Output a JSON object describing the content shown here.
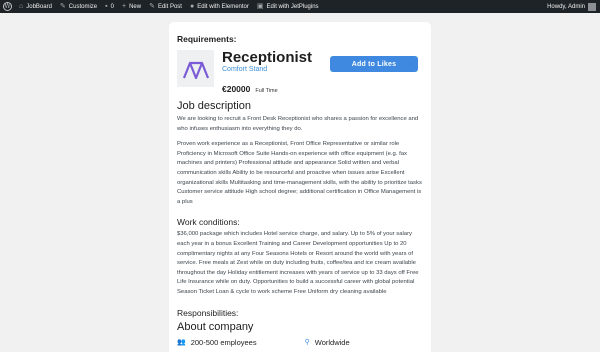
{
  "adminbar": {
    "site_name": "JobBoard",
    "customize": "Customize",
    "comments_count": "0",
    "new_label": "New",
    "edit_post": "Edit Post",
    "edit_elementor": "Edit with Elementor",
    "edit_jetplugins": "Edit with JetPlugins",
    "howdy": "Howdy, Admin"
  },
  "job": {
    "requirements_heading": "Requirements:",
    "title": "Receptionist",
    "company": "Comfort Stand",
    "salary": "€20000",
    "job_type": "Full Time",
    "add_to_likes": "Add to Likes",
    "description_heading": "Job description",
    "description_p1": "We are looking to recruit a Front Desk Receptionist who shares a passion for excellence and who infuses enthusiasm into everything they do.",
    "description_p2": "Proven work experience as a Receptionist, Front Office Representative or similar role Proficiency in Microsoft Office Suite Hands-on experience with office equipment (e.g. fax machines and printers) Professional attitude and appearance Solid written and verbal communication skills Ability to be resourceful and proactive when issues arise Excellent organizational skills Multitasking and time-management skills, with the ability to prioritize tasks Customer service attitude High school degree; additional certification in Office Management is a plus",
    "work_conditions_heading": "Work conditions:",
    "work_conditions_text": "$36,000 package which includes Hotel service charge, and salary. Up to 5% of your salary each year in a bonus Excellent Training and Career Development opportunities Up to 20 complimentary nights at any Four Seasons Hotels or Resort around the world with years of service. Free meals at Zest while on duty including fruits, coffee/tea and ice cream available throughout the day Holiday entitlement increases with years of service up to 33 days off Free Life Insurance while on duty. Opportunities to build a successful career with global potential Season Ticket Loan & cycle to work scheme Free Uniform dry cleaning available",
    "responsibilities_heading": "Responsibilities:",
    "about_heading": "About company",
    "employees": "200-500 employees",
    "location": "Worldwide"
  },
  "colors": {
    "adminbar_bg": "#1d2327",
    "page_bg": "#f1f1f1",
    "accent": "#3f8ae0",
    "logo_purple": "#7b5cd6"
  },
  "icons": {
    "wp": "wordpress-icon",
    "home": "home-icon",
    "customize": "brush-icon",
    "comments": "comment-icon",
    "new": "plus-icon",
    "edit": "pencil-icon",
    "elementor": "elementor-icon",
    "jetplugins": "jetplugins-icon",
    "employees": "users-icon",
    "location": "map-pin-icon"
  }
}
